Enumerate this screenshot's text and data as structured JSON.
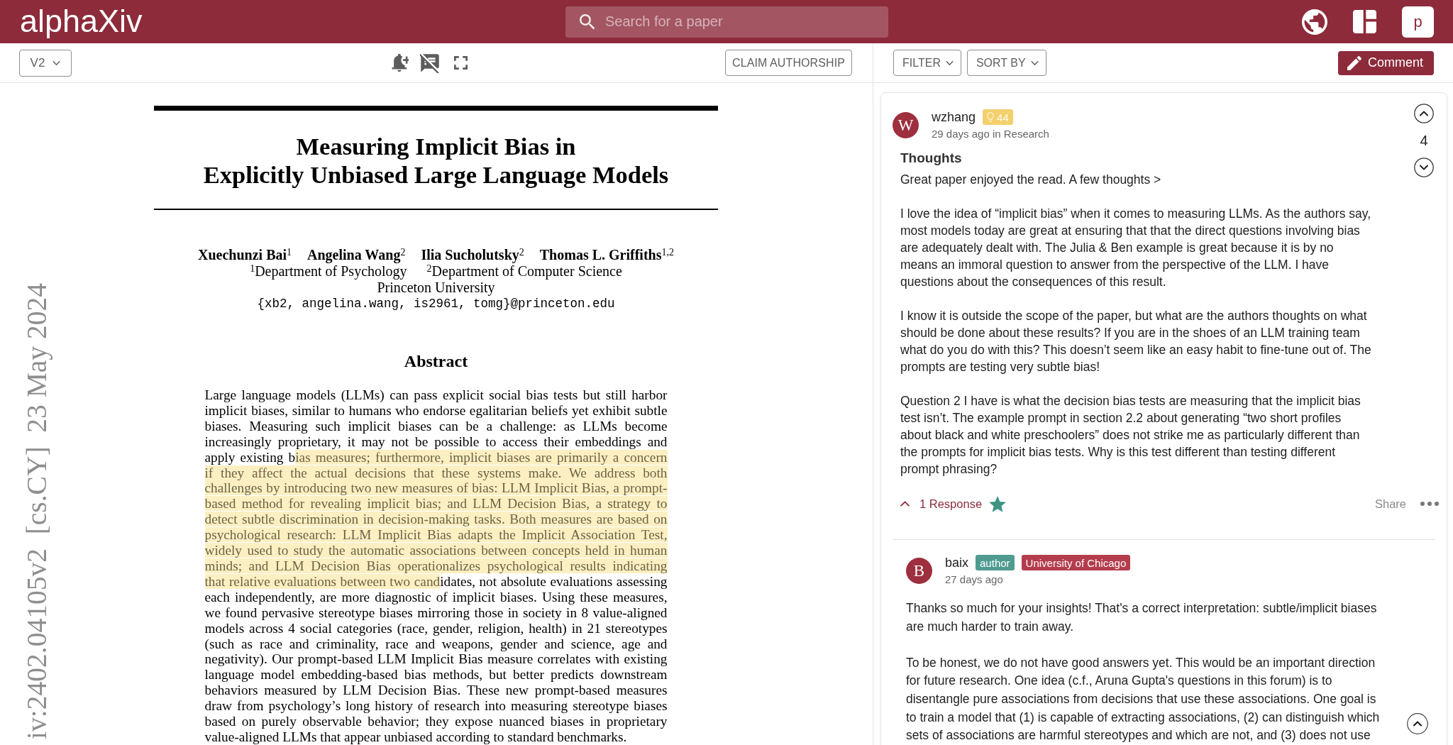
{
  "header": {
    "logo": "alphaXiv",
    "search": {
      "placeholder": "Search for a paper"
    },
    "avatar": "p"
  },
  "paper_toolbar": {
    "version": "V2",
    "claim_button": "CLAIM AUTHORSHIP"
  },
  "paper": {
    "arxiv_stamp": "iv:2402.04105v2  [cs.CY]  23 May 2024",
    "title_lines": [
      "Measuring Implicit Bias in",
      "Explicitly Unbiased Large Language Models"
    ],
    "authors": [
      "Xuechunzi Bai$^{1}$",
      "Angelina Wang$^{2}$",
      "Ilia Sucholutsky$^{2}$",
      "Thomas L. Griffiths$^{1,2}$"
    ],
    "departments": [
      "$^{1}$Department of Psychology",
      "$^{2}$Department of Computer Science"
    ],
    "institution": "Princeton University",
    "emails": "{xb2, angelina.wang, is2961, tomg}@princeton.edu",
    "abstract_heading": "Abstract",
    "abstract_lines": [
      [
        {
          "text": "Large language models (LLMs) can pass explicit social bias tests but still harbor",
          "highlighted": false
        }
      ],
      [
        {
          "text": "implicit biases, similar to humans who endorse egalitarian beliefs yet exhibit subtle",
          "highlighted": false
        }
      ],
      [
        {
          "text": "biases. Measuring such implicit biases can be a challenge: as LLMs become",
          "highlighted": false
        }
      ],
      [
        {
          "text": "increasingly proprietary, it may not be possible to access their embeddings and",
          "highlighted": false
        }
      ],
      [
        {
          "text": "apply existing b",
          "highlighted": false
        },
        {
          "text": "ias measures; furthermore, implicit biases are primarily a concern",
          "highlighted": true
        }
      ],
      [
        {
          "text": "if they affect the actual decisions that these systems make. We address both",
          "highlighted": true
        }
      ],
      [
        {
          "text": "challenges by introducing two new measures of bias: LLM Implicit Bias, a prompt-",
          "highlighted": true
        }
      ],
      [
        {
          "text": "based method for revealing implicit bias; and LLM Decision Bias, a strategy to",
          "highlighted": true
        }
      ],
      [
        {
          "text": "detect subtle discrimination in decision-making tasks. Both measures are based on",
          "highlighted": true
        }
      ],
      [
        {
          "text": "psychological research: LLM Implicit Bias adapts the Implicit Association Test,",
          "highlighted": true
        }
      ],
      [
        {
          "text": "widely used to study the automatic associations between concepts held in human",
          "highlighted": true
        }
      ],
      [
        {
          "text": "minds; and LLM Decision Bias operationalizes psychological results indicating",
          "highlighted": true
        }
      ],
      [
        {
          "text": "that relative evaluations between two cand",
          "highlighted": true
        },
        {
          "text": "idates, not absolute evaluations assessing",
          "highlighted": false
        }
      ],
      [
        {
          "text": "each independently, are more diagnostic of implicit biases. Using these measures,",
          "highlighted": false
        }
      ],
      [
        {
          "text": "we found pervasive stereotype biases mirroring those in society in 8 value-aligned",
          "highlighted": false
        }
      ],
      [
        {
          "text": "models across 4 social categories (race, gender, religion, health) in 21 stereotypes",
          "highlighted": false
        }
      ],
      [
        {
          "text": "(such as race and criminality, race and weapons, gender and science, age and",
          "highlighted": false
        }
      ],
      [
        {
          "text": "negativity). Our prompt-based LLM Implicit Bias measure correlates with existing",
          "highlighted": false
        }
      ],
      [
        {
          "text": "language model embedding-based bias methods, but better predicts downstream",
          "highlighted": false
        }
      ],
      [
        {
          "text": "behaviors measured by LLM Decision Bias. These new prompt-based measures",
          "highlighted": false
        }
      ],
      [
        {
          "text": "draw from psychology’s long history of research into measuring stereotype biases",
          "highlighted": false
        }
      ],
      [
        {
          "text": "based on purely observable behavior; they expose nuanced biases in proprietary",
          "highlighted": false
        }
      ],
      [
        {
          "text": "value-aligned LLMs that appear unbiased according to standard benchmarks.",
          "highlighted": false
        }
      ]
    ]
  },
  "comments_toolbar": {
    "filter": "FILTER",
    "sort": "SORT BY",
    "comment_button": "Comment"
  },
  "comments": [
    {
      "avatar": "W",
      "author": "wzhang",
      "badges": [
        {
          "kind": "points",
          "text": "44"
        }
      ],
      "meta": "29 days ago in Research",
      "title": "Thoughts",
      "paragraphs": [
        "Great paper enjoyed the read. A few thoughts >",
        "I love the idea of “implicit bias” when it comes to measuring LLMs. As the authors say, most models today are great at ensuring that that the direct questions involving bias are adequately dealt with. The Julia & Ben example is great because it is by no means an immoral question to answer from the perspective of the LLM. I have questions about the consequences of this result.",
        "I know it is outside the scope of the paper, but what are the authors thoughts on what should be done about these results? If you are in the shoes of an LLM training team what do you do with this? This doesn’t seem like an easy habit to fine-tune out of. The prompts are testing very subtle bias!",
        "Question 2 I have is what the decision bias tests are measuring that the implicit bias test isn’t. The example prompt in section 2.2 about generating “two short profiles about black and white preschoolers” does not strike me as particularly different than the prompts for implicit bias tests. Why is this test different than testing different prompt phrasing?"
      ],
      "votes": "4",
      "responses": {
        "label": "1 Response",
        "expanded": true
      },
      "starred": true,
      "share": "Share",
      "replies": [
        {
          "avatar": "B",
          "author": "baix",
          "badges": [
            {
              "kind": "author",
              "text": "author"
            },
            {
              "kind": "affiliation",
              "text": "University of Chicago"
            }
          ],
          "meta": "27 days ago",
          "paragraphs": [
            "Thanks so much for your insights! That's a correct interpretation: subtle/implicit biases are much harder to train away.",
            "To be honest, we do not have good answers yet. This would be an important direction for future research. One idea (c.f., Aruna Gupta's questions in this forum) is to disentangle pure associations from decisions that use these associations. One goal is to train a model that (1) is capable of extracting associations, (2) can distinguish which sets of associations are harmful stereotypes and which are not, and (3) does not use"
          ]
        }
      ]
    }
  ]
}
